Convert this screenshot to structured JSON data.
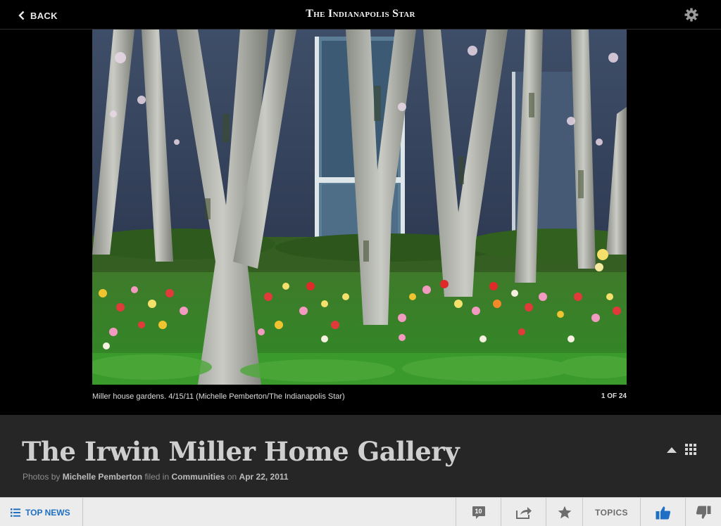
{
  "header": {
    "back_label": "BACK",
    "brand": "The Indianapolis Star"
  },
  "photo": {
    "caption": "Miller house gardens. 4/15/11 (Michelle Pemberton/The Indianapolis Star)",
    "counter": "1 OF 24"
  },
  "gallery": {
    "title": "The Irwin Miller Home Gallery",
    "photos_by_prefix": "Photos by",
    "photographer": "Michelle Pemberton",
    "filed_in_prefix": "filed in",
    "section": "Communities",
    "date_prefix": "on",
    "date": "Apr 22, 2011"
  },
  "toolbar": {
    "top_news_label": "TOP NEWS",
    "comment_count": "10",
    "topics_label": "TOPICS"
  },
  "colors": {
    "accent_blue": "#1f6fc4",
    "info_panel_bg": "#262626",
    "toolbar_bg": "#ececec"
  },
  "icons": {
    "back": "chevron-left-icon",
    "settings": "gear-icon",
    "collapse": "triangle-up-icon",
    "grid": "grid-icon",
    "list": "list-icon",
    "comments": "speech-bubble-icon",
    "share": "share-icon",
    "favorite": "star-icon",
    "like": "thumbs-up-icon",
    "dislike": "thumbs-down-icon"
  }
}
